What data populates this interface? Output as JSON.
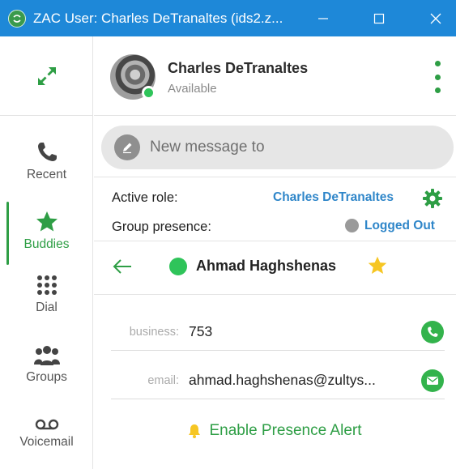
{
  "window": {
    "title": "ZAC User: Charles DeTranaltes (ids2.z...",
    "controls": {
      "minimize": "—",
      "maximize": "☐",
      "close": "✕"
    },
    "accent": "#1e88d8"
  },
  "nav": {
    "items": [
      {
        "label": "Recent",
        "icon": "phone-icon",
        "active": false
      },
      {
        "label": "Buddies",
        "icon": "star-icon",
        "active": true
      },
      {
        "label": "Dial",
        "icon": "dialpad-icon",
        "active": false
      },
      {
        "label": "Groups",
        "icon": "groups-icon",
        "active": false
      },
      {
        "label": "Voicemail",
        "icon": "voicemail-icon",
        "active": false
      }
    ],
    "active_color": "#2e9e45"
  },
  "user": {
    "name": "Charles DeTranaltes",
    "status": "Available",
    "status_color": "#2fc45a"
  },
  "message": {
    "placeholder": "New message to"
  },
  "role": {
    "active_role_label": "Active role:",
    "active_role_value": "Charles DeTranaltes",
    "group_presence_label": "Group presence:",
    "group_presence_value": "Logged Out",
    "value_color": "#2f86c9"
  },
  "contact": {
    "name": "Ahmad Haghshenas",
    "favorite": true,
    "fields": [
      {
        "label": "business:",
        "value": "753",
        "action_icon": "phone-icon"
      },
      {
        "label": "email:",
        "value": "ahmad.haghshenas@zultys...",
        "action_icon": "mail-icon"
      }
    ]
  },
  "alert": {
    "label": "Enable Presence Alert",
    "icon": "bell-icon"
  }
}
